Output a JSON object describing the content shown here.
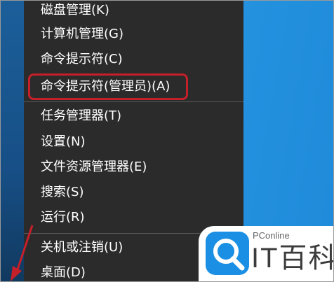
{
  "menu": {
    "items": [
      {
        "label": "磁盘管理(K)",
        "underline": "K"
      },
      {
        "label": "计算机管理(G)",
        "underline": "G"
      },
      {
        "label": "命令提示符(C)",
        "underline": "C"
      },
      {
        "label": "命令提示符(管理员)(A)",
        "underline": "A"
      },
      {
        "label": "任务管理器(T)",
        "underline": "T"
      },
      {
        "label": "设置(N)",
        "underline": "N"
      },
      {
        "label": "文件资源管理器(E)",
        "underline": "E"
      },
      {
        "label": "搜索(S)",
        "underline": "S"
      },
      {
        "label": "运行(R)",
        "underline": "R"
      },
      {
        "label": "关机或注销(U)",
        "underline": "U"
      },
      {
        "label": "桌面(D)",
        "underline": "D"
      }
    ],
    "highlighted_item": "命令提示符(管理员)(A)"
  },
  "watermark": {
    "small_text": "PConline",
    "big_text": "IT百科"
  },
  "colors": {
    "menu_bg": "#2b2b2b",
    "menu_text": "#ffffff",
    "highlight_border": "#c4202a",
    "desktop": "#1e8fdd",
    "arrow": "#c4202a",
    "watermark_accent": "#1a8fe3"
  },
  "icons": [
    "red-arrow-annotation-icon",
    "magnifier-logo-icon"
  ]
}
